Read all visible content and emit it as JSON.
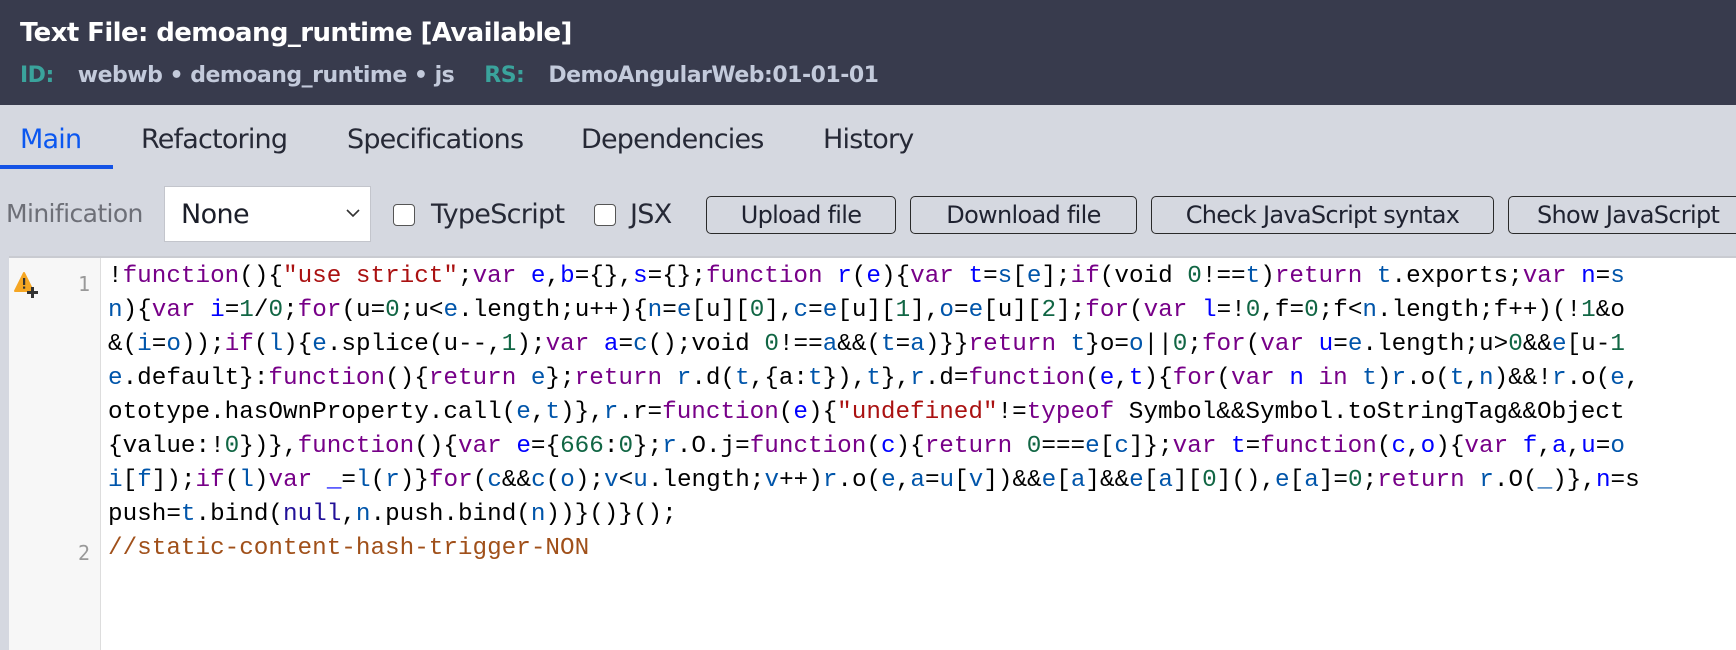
{
  "header": {
    "title": "Text File: demoang_runtime [Available]",
    "id_label": "ID:",
    "id_value": "webwb • demoang_runtime • js",
    "rs_label": "RS:",
    "rs_value": "DemoAngularWeb:01-01-01"
  },
  "tabs": [
    {
      "label": "Main",
      "active": true
    },
    {
      "label": "Refactoring",
      "active": false
    },
    {
      "label": "Specifications",
      "active": false
    },
    {
      "label": "Dependencies",
      "active": false
    },
    {
      "label": "History",
      "active": false
    }
  ],
  "toolbar": {
    "minification_label": "Minification",
    "minification_value": "None",
    "typescript_label": "TypeScript",
    "typescript_checked": false,
    "jsx_label": "JSX",
    "jsx_checked": false,
    "upload_label": "Upload file",
    "download_label": "Download file",
    "check_syntax_label": "Check JavaScript syntax",
    "show_js_label": "Show JavaScript"
  },
  "editor": {
    "line_numbers": [
      "1",
      "2"
    ],
    "gutter_icon": "warning-icon",
    "colors": {
      "accent": "#1453e6",
      "header_bg": "#383b4d",
      "id_label": "#3aa39c"
    },
    "line1_wrapped": [
      "!function(){\"use strict\";var e,b={},s={};function r(e){var t=s[e];if(void 0!==t)return t.exports;var n=s",
      "n){var i=1/0;for(u=0;u<e.length;u++){n=e[u][0],c=e[u][1],o=e[u][2];for(var l=!0,f=0;f<n.length;f++)(!1&o",
      "&(i=o));if(l){e.splice(u--,1);var a=c();void 0!==a&&(t=a)}}return t}o=o||0;for(var u=e.length;u>0&&e[u-1",
      "e.default}:function(){return e};return r.d(t,{a:t}),t},r.d=function(e,t){for(var n in t)r.o(t,n)&&!r.o(e,",
      "ototype.hasOwnProperty.call(e,t)},r.r=function(e){\"undefined\"!=typeof Symbol&&Symbol.toStringTag&&Object",
      "{value:!0})},function(){var e={666:0};r.O.j=function(c){return 0===e[c]};var t=function(c,o){var f,a,u=o",
      "i[f]);if(l)var _=l(r)}for(c&&c(o);v<u.length;v++)r.o(e,a=u[v])&&e[a]&&e[a][0](),e[a]=0;return r.O(_)},n=s",
      "push=t.bind(null,n.push.bind(n))}()}();"
    ],
    "line2": "//static-content-hash-trigger-NON"
  }
}
